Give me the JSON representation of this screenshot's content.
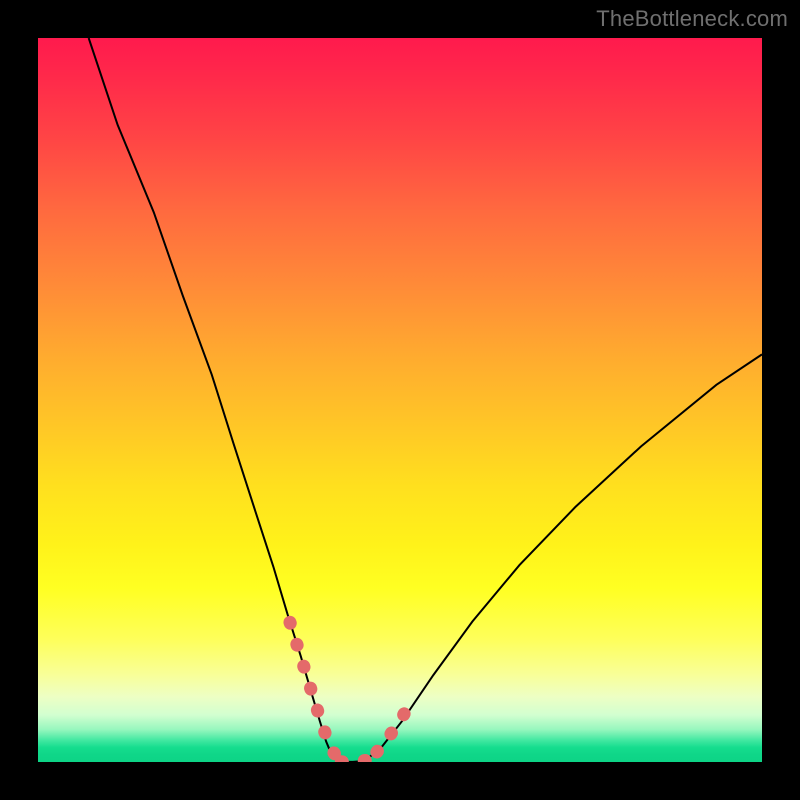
{
  "watermark": "TheBottleneck.com",
  "chart_data": {
    "type": "line",
    "title": "",
    "xlabel": "",
    "ylabel": "",
    "xlim": [
      0,
      100
    ],
    "ylim": [
      0,
      100
    ],
    "grid": false,
    "series": [
      {
        "name": "curve",
        "stroke": "#000000",
        "stroke_width": 2,
        "x": [
          7,
          11,
          16,
          20,
          24,
          27,
          30,
          32.5,
          34.5,
          36.3,
          37.7,
          38.9,
          39.8,
          40.5,
          41.3,
          42.3,
          43.5,
          45,
          47.2,
          50.3,
          54.6,
          60,
          66.5,
          74.2,
          83.3,
          93.7,
          100
        ],
        "y": [
          100,
          88,
          75.9,
          64.4,
          53.5,
          44,
          34.7,
          27,
          20.3,
          14.6,
          9.8,
          5.73,
          2.83,
          1.15,
          0.248,
          0.0138,
          0.0138,
          0.138,
          1.73,
          5.67,
          12,
          19.4,
          27.2,
          35.2,
          43.6,
          52.1,
          56.3
        ]
      },
      {
        "name": "highlight-left",
        "stroke": "#e46a6a",
        "stroke_width": 13,
        "linecap": "round",
        "dash": "1 22",
        "x": [
          34.8,
          36.9,
          38.5,
          39.7,
          40.6,
          41.4
        ],
        "y": [
          19.3,
          12.6,
          7.44,
          3.87,
          1.66,
          0.497
        ]
      },
      {
        "name": "highlight-bottom",
        "stroke": "#e46a6a",
        "stroke_width": 13,
        "linecap": "round",
        "dash": "1 22",
        "x": [
          41.9,
          43.1,
          44.4,
          45.8
        ],
        "y": [
          0.0276,
          0,
          0.0553,
          0.331
        ]
      },
      {
        "name": "highlight-right",
        "stroke": "#e46a6a",
        "stroke_width": 13,
        "linecap": "round",
        "dash": "1 22",
        "x": [
          46.8,
          48.5,
          50.4,
          51.9
        ],
        "y": [
          1.38,
          3.52,
          6.35,
          9.03
        ]
      }
    ],
    "background_gradient": {
      "direction": "top-to-bottom",
      "stops": [
        {
          "pos": 0.0,
          "color": "#ff1a4d"
        },
        {
          "pos": 0.5,
          "color": "#ffc826"
        },
        {
          "pos": 0.78,
          "color": "#ffff22"
        },
        {
          "pos": 0.92,
          "color": "#edffc4"
        },
        {
          "pos": 1.0,
          "color": "#0dd486"
        }
      ]
    }
  }
}
